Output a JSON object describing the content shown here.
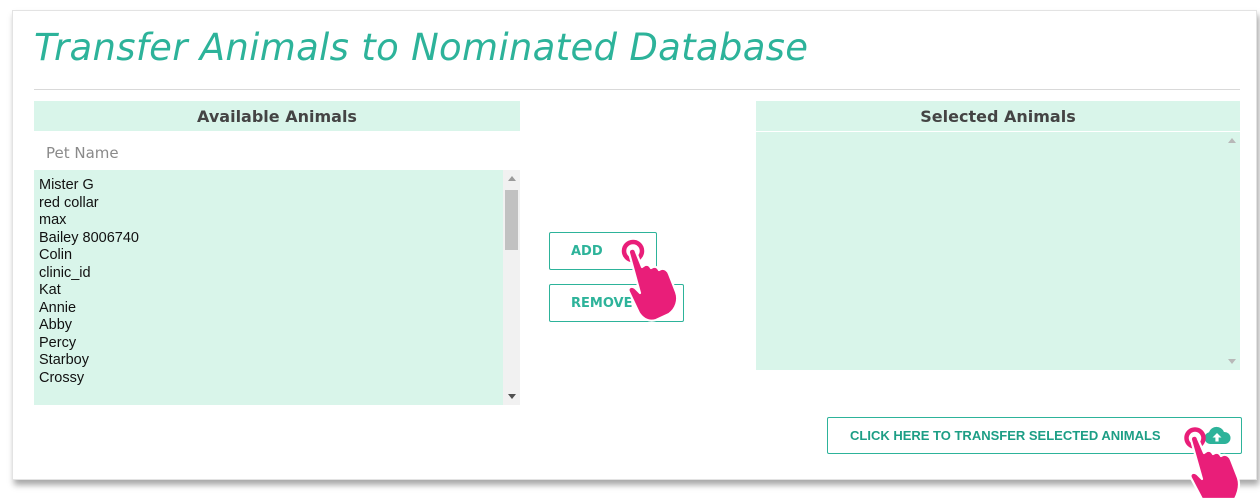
{
  "page": {
    "title": "Transfer Animals to Nominated Database"
  },
  "available": {
    "header": "Available Animals",
    "search_placeholder": "Pet Name",
    "items": [
      "Mister G",
      "red collar",
      "max",
      "Bailey 8006740",
      "Colin",
      "clinic_id",
      "Kat",
      "Annie",
      "Abby",
      "Percy",
      "Starboy",
      "Crossy"
    ]
  },
  "selected": {
    "header": "Selected Animals",
    "items": []
  },
  "buttons": {
    "add": "ADD",
    "remove": "REMOVE",
    "transfer": "CLICK HERE TO TRANSFER SELECTED ANIMALS"
  },
  "icons": {
    "cloud": "cloud-upload-icon",
    "pointer": "pointing-hand-icon"
  },
  "colors": {
    "accent": "#2db39a",
    "list_bg": "#d9f5ea",
    "pointer": "#e91e79"
  }
}
